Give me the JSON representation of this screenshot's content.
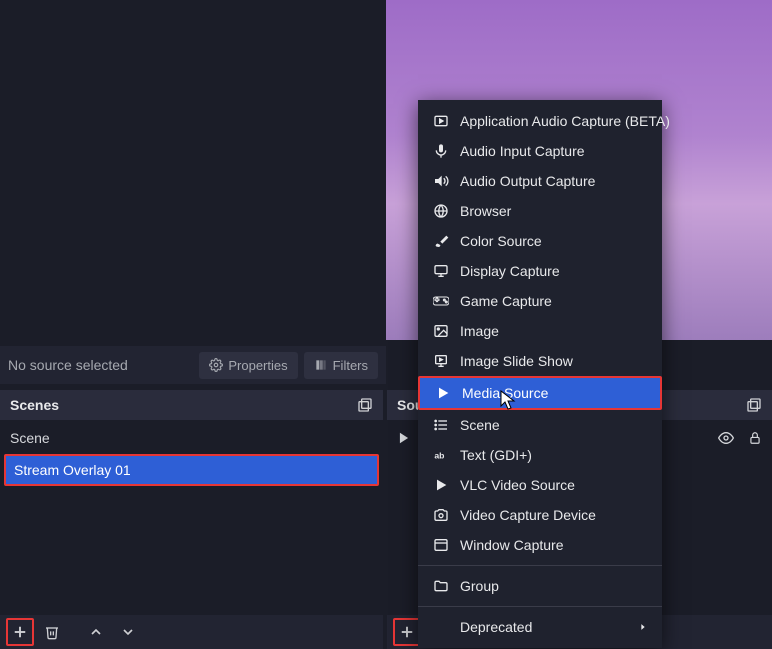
{
  "toolbar": {
    "status": "No source selected",
    "properties_label": "Properties",
    "filters_label": "Filters"
  },
  "scenes": {
    "title": "Scenes",
    "items": [
      "Scene",
      "Stream Overlay 01"
    ],
    "selected_index": 1
  },
  "sources": {
    "title": "Sources"
  },
  "context_menu": {
    "items": [
      {
        "icon": "app-audio-icon",
        "label": "Application Audio Capture (BETA)"
      },
      {
        "icon": "mic-icon",
        "label": "Audio Input Capture"
      },
      {
        "icon": "speaker-icon",
        "label": "Audio Output Capture"
      },
      {
        "icon": "globe-icon",
        "label": "Browser"
      },
      {
        "icon": "brush-icon",
        "label": "Color Source"
      },
      {
        "icon": "monitor-icon",
        "label": "Display Capture"
      },
      {
        "icon": "gamepad-icon",
        "label": "Game Capture"
      },
      {
        "icon": "image-icon",
        "label": "Image"
      },
      {
        "icon": "slideshow-icon",
        "label": "Image Slide Show"
      },
      {
        "icon": "play-icon",
        "label": "Media Source",
        "selected": true
      },
      {
        "icon": "list-icon",
        "label": "Scene"
      },
      {
        "icon": "text-icon",
        "label": "Text (GDI+)"
      },
      {
        "icon": "play-icon",
        "label": "VLC Video Source"
      },
      {
        "icon": "camera-icon",
        "label": "Video Capture Device"
      },
      {
        "icon": "window-icon",
        "label": "Window Capture"
      }
    ],
    "group_label": "Group",
    "deprecated_label": "Deprecated"
  }
}
